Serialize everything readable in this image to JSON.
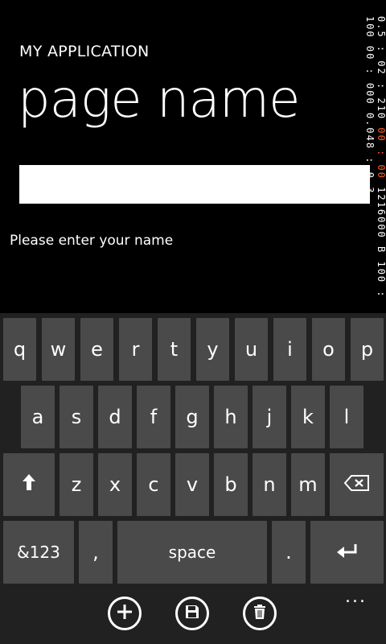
{
  "app": {
    "application_title": "MY APPLICATION",
    "page_title": "page name"
  },
  "form": {
    "name_value": "",
    "hint": "Please enter your name"
  },
  "debug_counter": {
    "lines": [
      "0.5 : 02 : 210",
      "00 : 00",
      "1216000 B",
      "100 : 100",
      "00 : 000",
      "0.048 : 0.3"
    ]
  },
  "keyboard": {
    "row1": [
      "q",
      "w",
      "e",
      "r",
      "t",
      "y",
      "u",
      "i",
      "o",
      "p"
    ],
    "row2": [
      "a",
      "s",
      "d",
      "f",
      "g",
      "h",
      "j",
      "k",
      "l"
    ],
    "row3": [
      "z",
      "x",
      "c",
      "v",
      "b",
      "n",
      "m"
    ],
    "shift_icon": "shift-arrow-icon",
    "backspace_icon": "backspace-icon",
    "symbols_label": "&123",
    "comma_label": ",",
    "space_label": "space",
    "period_label": ".",
    "enter_icon": "enter-icon"
  },
  "appbar": {
    "buttons": [
      "add-icon",
      "save-icon",
      "delete-icon"
    ],
    "more_label": "..."
  }
}
